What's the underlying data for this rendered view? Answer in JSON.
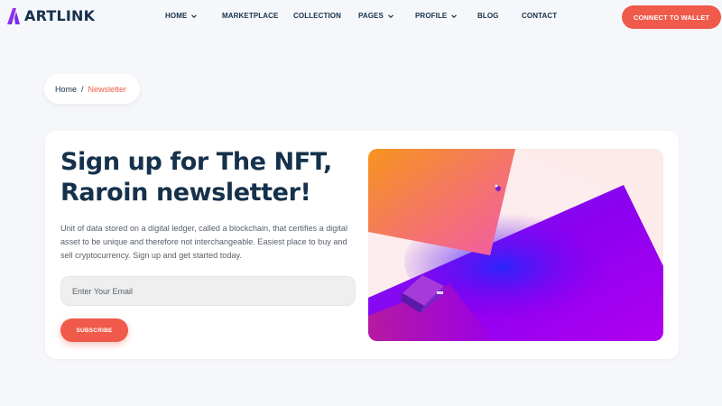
{
  "brand": {
    "name": "ARTLINK",
    "logo_color": "#8a3ffc"
  },
  "nav": {
    "items": [
      {
        "label": "HOME",
        "has_dropdown": true
      },
      {
        "label": "MARKETPLACE",
        "has_dropdown": false
      },
      {
        "label": "COLLECTION",
        "has_dropdown": false
      },
      {
        "label": "PAGES",
        "has_dropdown": true
      },
      {
        "label": "PROFILE",
        "has_dropdown": true
      },
      {
        "label": "BLOG",
        "has_dropdown": false
      },
      {
        "label": "CONTACT",
        "has_dropdown": false
      }
    ],
    "wallet_button": "CONNECT TO WALLET"
  },
  "breadcrumb": {
    "home": "Home",
    "separator": "/",
    "current": "Newsletter"
  },
  "newsletter": {
    "heading_line1": "Sign up for The NFT,",
    "heading_line2": "Raroin newsletter!",
    "description": "Unit of data stored on a digital ledger, called a blockchain, that certifies a digital asset to be unique and therefore not interchangeable. Easiest place to buy and sell cryptocurrency. Sign up and get started today.",
    "email_placeholder": "Enter Your Email",
    "email_value": "",
    "subscribe_label": "SUBSCRIBE"
  },
  "colors": {
    "accent": "#ef5a4a",
    "heading": "#15314b",
    "background": "#f6f7fb",
    "art_purple": "#8a00f0",
    "art_orange": "#f7941d",
    "art_pink": "#fdeced"
  }
}
